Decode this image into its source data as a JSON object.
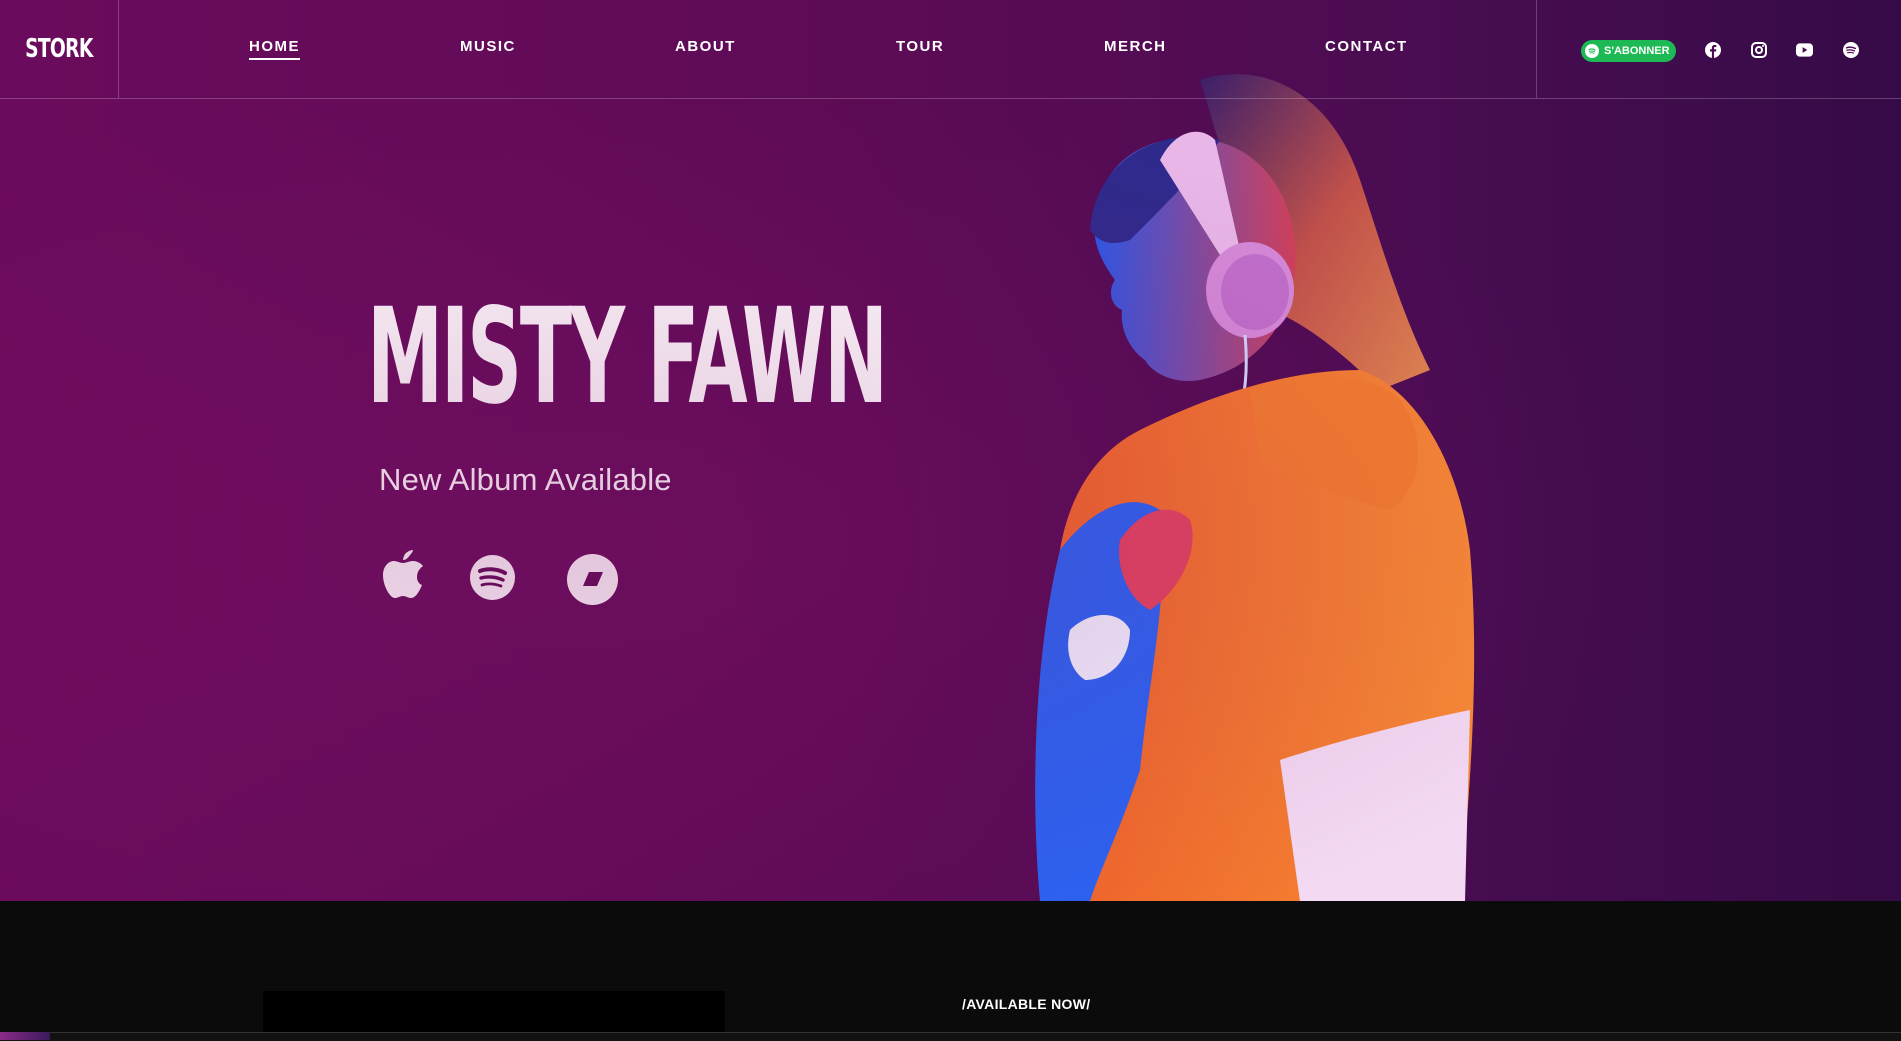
{
  "brand": {
    "logo": "STORK"
  },
  "nav": {
    "items": [
      {
        "label": "HOME",
        "active": true
      },
      {
        "label": "MUSIC",
        "active": false
      },
      {
        "label": "ABOUT",
        "active": false
      },
      {
        "label": "TOUR",
        "active": false
      },
      {
        "label": "MERCH",
        "active": false
      },
      {
        "label": "CONTACT",
        "active": false
      }
    ],
    "subscribe_label": "S'ABONNER",
    "social_icons": [
      "facebook-icon",
      "instagram-icon",
      "youtube-icon",
      "spotify-icon"
    ]
  },
  "hero": {
    "artist": "MISTY FAWN",
    "subtitle": "New Album Available",
    "services": [
      "apple-music-icon",
      "spotify-icon",
      "deezer-icon"
    ]
  },
  "section": {
    "heading": "/AVAILABLE NOW/"
  },
  "colors": {
    "hero_bg": "#5e0b56",
    "hero_bg_right": "#350b47",
    "spotify_green": "#1db954",
    "page_bg": "#0b0b0b",
    "hoodie": "#f07a2a"
  }
}
